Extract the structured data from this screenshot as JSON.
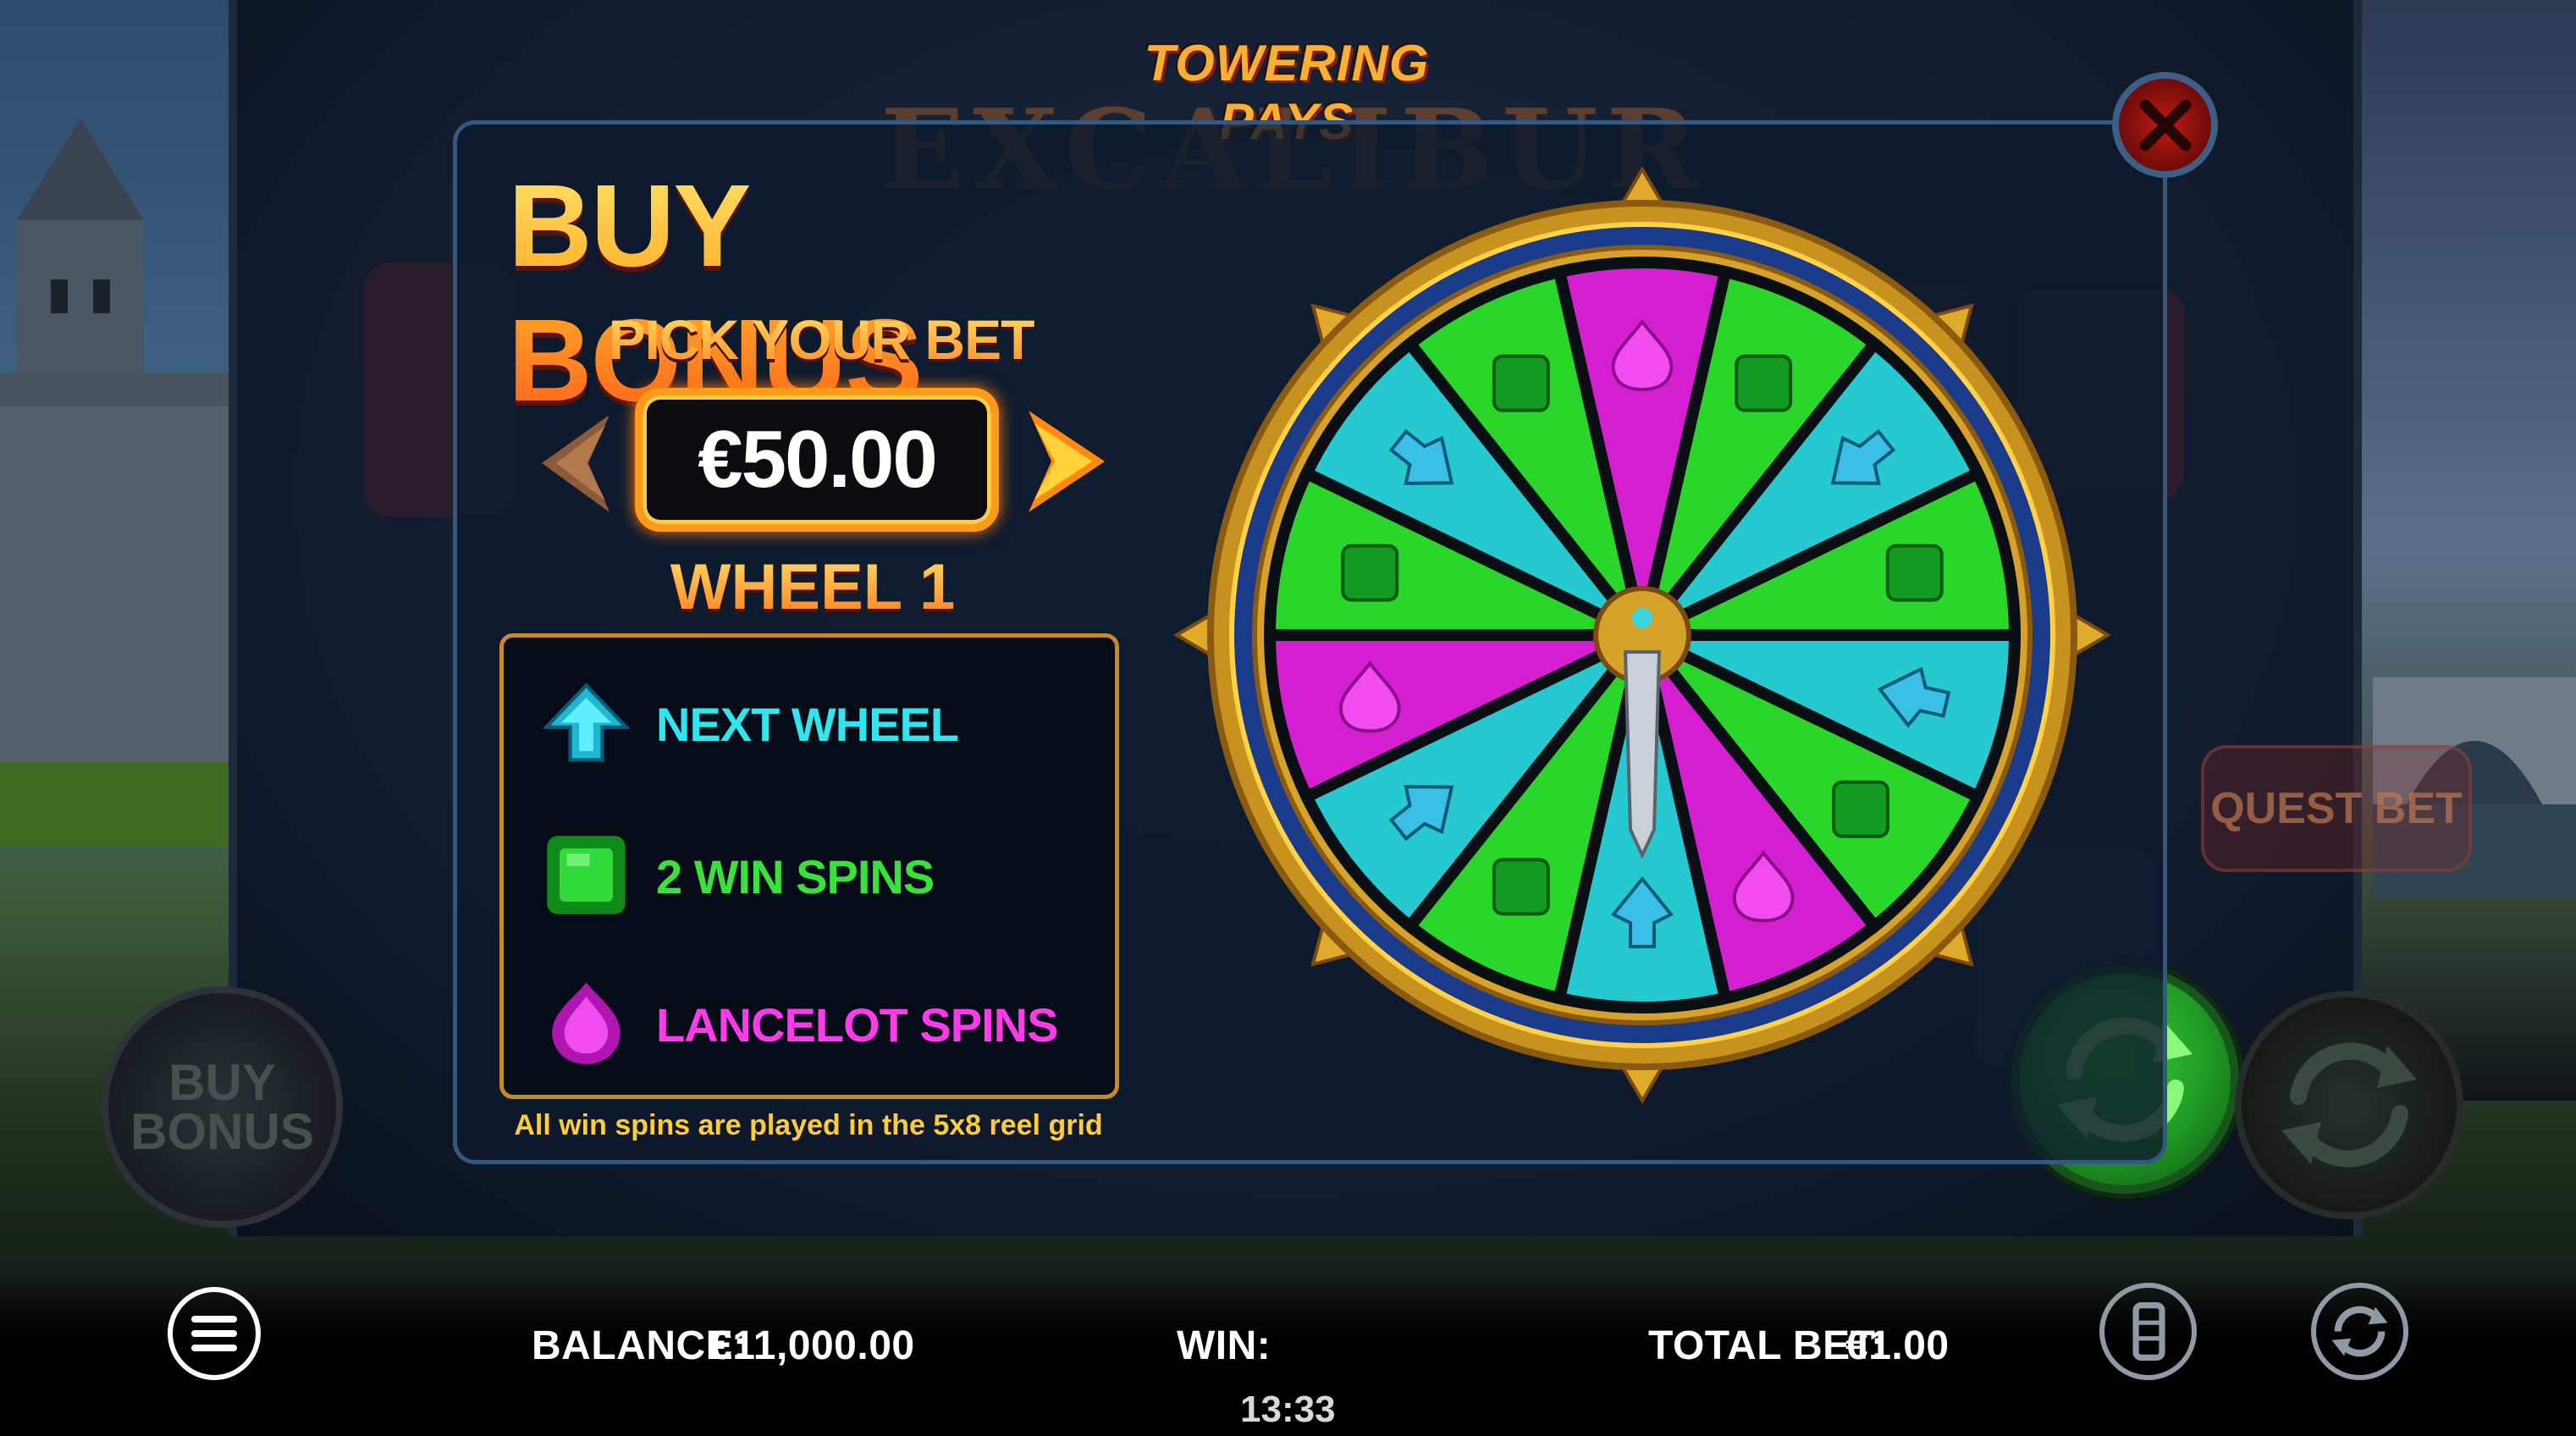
{
  "game": {
    "logo_title": "TOWERING PAYS",
    "logo_subtitle": "EXCALIBUR"
  },
  "modal": {
    "title": "BUY BONUS",
    "pick_label": "PICK YOUR BET",
    "bet_value": "€50.00",
    "wheel_label": "WHEEL 1",
    "legend": [
      {
        "label": "NEXT WHEEL",
        "icon": "cyan-arrow-gem-icon",
        "color": "#2fe6ee"
      },
      {
        "label": "2 WIN SPINS",
        "icon": "green-square-gem-icon",
        "color": "#38e23a"
      },
      {
        "label": "LANCELOT SPINS",
        "icon": "magenta-drop-gem-icon",
        "color": "#ff3aea"
      }
    ],
    "note": "All win spins are played in the 5x8 reel grid"
  },
  "side": {
    "buy_bonus_line1": "BUY",
    "buy_bonus_line2": "BONUS",
    "quest_bet": "QUEST BET"
  },
  "bottom_bar": {
    "balance_label": "BALANCE:",
    "balance_value": "€11,000.00",
    "win_label": "WIN:",
    "win_value": "",
    "total_bet_label": "TOTAL BET:",
    "total_bet_value": "€1.00",
    "clock": "13:33"
  },
  "wheel": {
    "segments": [
      "magenta",
      "green",
      "cyan",
      "green",
      "cyan",
      "green",
      "magenta",
      "cyan",
      "green",
      "cyan",
      "magenta",
      "green",
      "cyan",
      "green"
    ],
    "colors": {
      "magenta": "#d41fd0",
      "green": "#2bd62a",
      "cyan": "#25c9cf",
      "rim": "#d6a22a"
    }
  }
}
